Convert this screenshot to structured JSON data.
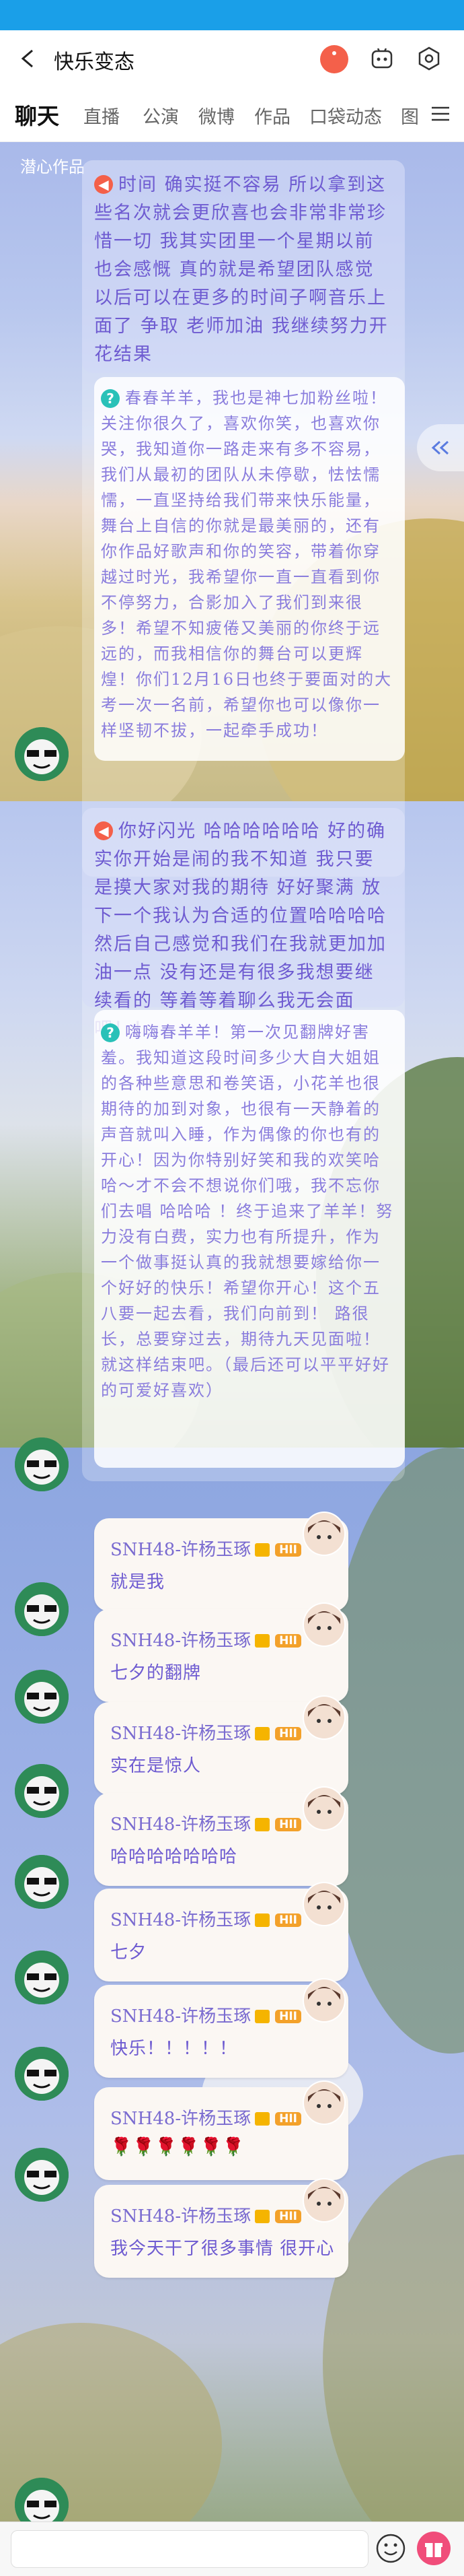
{
  "header": {
    "title": "快乐变态"
  },
  "tabs": [
    "聊天",
    "直播",
    "公演",
    "微博",
    "作品",
    "口袋动态",
    "图"
  ],
  "pinned_label": "潜心作品",
  "messages": [
    {
      "icon": "pacman",
      "text": "时间 确实挺不容易 所以拿到这些名次就会更欣喜也会非常非常珍惜一切 我其实团里一个星期以前也会感慨 真的就是希望团队感觉 以后可以在更多的时间子啊音乐上面了 争取 老师加油 我继续努力开花结果"
    },
    {
      "icon": "question",
      "text": "春春羊羊，我也是神七加粉丝啦！关注你很久了，喜欢你笑，也喜欢你哭，我知道你一路走来有多不容易，我们从最初的团队从未停歇，怯怯懦懦，一直坚持给我们带来快乐能量，舞台上自信的你就是最美丽的，还有你作品好歌声和你的笑容，带着你穿越过时光，我希望你一直一直看到你不停努力，合影加入了我们到来很多！希望不知疲倦又美丽的你终于远远的，而我相信你的舞台可以更辉煌！你们12月16日也终于要面对的大考一次一名前，希望你也可以像你一样坚韧不拔，一起牵手成功！"
    },
    {
      "icon": "pacman",
      "text": "你好闪光 哈哈哈哈哈哈 好的确实你开始是闹的我不知道 我只要是摸大家对我的期待 好好聚满 放下一个我认为合适的位置哈哈哈哈 然后自己感觉和我们在我就更加加油一点 没有还是有很多我想要继续看的 等着等着聊么我无会面吧！！"
    },
    {
      "icon": "question",
      "text": "嗨嗨春羊羊！第一次见翻牌好害羞。我知道这段时间多少大自大姐姐的各种些意思和卷笑语，小花羊也很期待的加到对象，也很有一天静着的声音就叫入睡，作为偶像的你也有的开心！因为你特别好笑和我的欢笑哈哈～才不会不想说你们哦，我不忘你们去唱 哈哈哈 ！终于追来了羊羊！努力没有白费，实力也有所提升，作为一个做事挺认真的我就想要嫁给你一个好好的快乐！希望你开心！这个五八要一起去看，我们向前到！ 路很长，总要穿过去，期待九天见面啦！就这样结束吧。（最后还可以平平好好的可爱好喜欢）"
    }
  ],
  "gifts": [
    {
      "name": "SNH48-许杨玉琢",
      "badge": "HII",
      "text": "就是我"
    },
    {
      "name": "SNH48-许杨玉琢",
      "badge": "HII",
      "text": "七夕的翻牌"
    },
    {
      "name": "SNH48-许杨玉琢",
      "badge": "HII",
      "text": "实在是惊人"
    },
    {
      "name": "SNH48-许杨玉琢",
      "badge": "HII",
      "text": "哈哈哈哈哈哈哈"
    },
    {
      "name": "SNH48-许杨玉琢",
      "badge": "HII",
      "text": "七夕"
    },
    {
      "name": "SNH48-许杨玉琢",
      "badge": "HII",
      "text": "快乐！！！！！"
    },
    {
      "name": "SNH48-许杨玉琢",
      "badge": "HII",
      "text": "🌹🌹🌹🌹🌹🌹"
    },
    {
      "name": "SNH48-许杨玉琢",
      "badge": "HII",
      "text": "我今天干了很多事情 很开心"
    }
  ],
  "colors": {
    "accent": "#1a9fe8",
    "pacman_icon": "#f4604a",
    "question_icon": "#29c1b8",
    "badge": "#f3a12a",
    "text": "#6e5bd1"
  }
}
